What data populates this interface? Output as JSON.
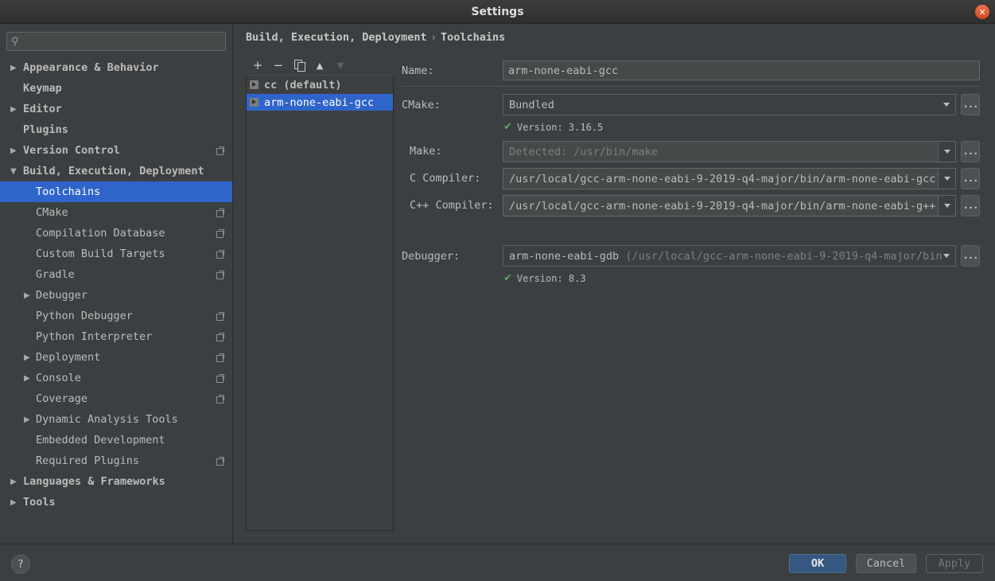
{
  "window": {
    "title": "Settings"
  },
  "search": {
    "placeholder": ""
  },
  "sidebar": {
    "items": [
      {
        "label": "Appearance & Behavior",
        "expandable": true,
        "expanded": false
      },
      {
        "label": "Keymap"
      },
      {
        "label": "Editor",
        "expandable": true,
        "expanded": false
      },
      {
        "label": "Plugins"
      },
      {
        "label": "Version Control",
        "expandable": true,
        "expanded": false,
        "project_icon": true
      },
      {
        "label": "Build, Execution, Deployment",
        "expandable": true,
        "expanded": true
      },
      {
        "label": "Toolchains",
        "selected": true
      },
      {
        "label": "CMake",
        "project_icon": true
      },
      {
        "label": "Compilation Database",
        "project_icon": true
      },
      {
        "label": "Custom Build Targets",
        "project_icon": true
      },
      {
        "label": "Gradle",
        "project_icon": true
      },
      {
        "label": "Debugger",
        "expandable": true
      },
      {
        "label": "Python Debugger",
        "project_icon": true
      },
      {
        "label": "Python Interpreter",
        "project_icon": true
      },
      {
        "label": "Deployment",
        "expandable": true,
        "project_icon": true
      },
      {
        "label": "Console",
        "expandable": true,
        "project_icon": true
      },
      {
        "label": "Coverage",
        "project_icon": true
      },
      {
        "label": "Dynamic Analysis Tools",
        "expandable": true
      },
      {
        "label": "Embedded Development"
      },
      {
        "label": "Required Plugins",
        "project_icon": true
      },
      {
        "label": "Languages & Frameworks",
        "expandable": true,
        "expanded": false
      },
      {
        "label": "Tools",
        "expandable": true,
        "expanded": false
      }
    ]
  },
  "breadcrumb": {
    "parent": "Build, Execution, Deployment",
    "separator": "›",
    "current": "Toolchains"
  },
  "toolchains": {
    "items": [
      {
        "label": "cc (default)"
      },
      {
        "label": "arm-none-eabi-gcc",
        "selected": true
      }
    ]
  },
  "form": {
    "name_label": "Name:",
    "name_value": "arm-none-eabi-gcc",
    "cmake_label": "CMake:",
    "cmake_value": "Bundled",
    "cmake_version": "Version: 3.16.5",
    "make_label": "Make:",
    "make_value": "Detected: /usr/bin/make",
    "c_label": "C Compiler:",
    "c_value": "/usr/local/gcc-arm-none-eabi-9-2019-q4-major/bin/arm-none-eabi-gcc",
    "cpp_label": "C++ Compiler:",
    "cpp_value": "/usr/local/gcc-arm-none-eabi-9-2019-q4-major/bin/arm-none-eabi-g++",
    "debugger_label": "Debugger:",
    "debugger_value": "arm-none-eabi-gdb",
    "debugger_path": "(/usr/local/gcc-arm-none-eabi-9-2019-q4-major/bin",
    "debugger_version": "Version: 8.3",
    "browse": "..."
  },
  "footer": {
    "help": "?",
    "ok": "OK",
    "cancel": "Cancel",
    "apply": "Apply"
  },
  "colors": {
    "accent": "#2f65ca",
    "primary_button": "#365880",
    "check": "#59a869"
  }
}
